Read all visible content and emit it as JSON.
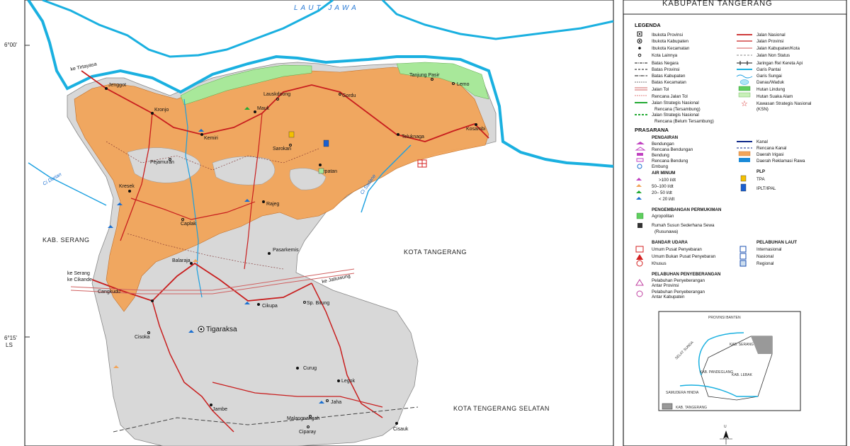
{
  "map": {
    "sea_label": "LAUT JAWA",
    "title": "KABUPATEN TANGERANG",
    "lat_ticks": [
      "6°00'",
      "6°15'",
      "LS"
    ],
    "regions": {
      "serang": "KAB. SERANG",
      "kota_tangerang": "KOTA TANGERANG",
      "kota_tangsel": "KOTA TENGERANG SELATAN"
    },
    "rivers": [
      "Ci Durian",
      "Ci Sadane"
    ],
    "places": [
      "Jenggot",
      "Kronjo",
      "Kemiri",
      "Mauk",
      "Lauskdoong",
      "Gordu",
      "Tanjung Pasir",
      "Lemo",
      "Kosambi",
      "Teluknaga",
      "Sepatan",
      "Sarokan",
      "Pejamuran",
      "Kresek",
      "Rajeg",
      "Caplak",
      "Pasarkemis",
      "Balaraja",
      "Cangkudu",
      "Cikupa",
      "Sp. Bitung",
      "Cisoka",
      "Tigaraksa",
      "Curug",
      "Legok",
      "Jambe",
      "Jaha",
      "Malangnangah",
      "Cisauk",
      "Ciparay"
    ],
    "road_labels": [
      "ke Tirtayasa",
      "ke Serang",
      "ke Cikande",
      "ke Jatiuwung"
    ]
  },
  "legend": {
    "title": "LEGENDA",
    "left_items": [
      "Ibukota Provinsi",
      "Ibukota Kabupaten",
      "Ibukota Kecamatan",
      "Kota Lainnya",
      "Batas Negara",
      "Batas Provinsi",
      "Batas Kabupaten",
      "Batas Kecamatan",
      "Jalan Tol",
      "Rencana Jalan Tol",
      "Jalan Strategis Nasional",
      "Rencana (Tersambung)",
      "Jalan Strategis Nasional",
      "Rencana (Belum Tersambung)"
    ],
    "right_items": [
      "Jalan Nasional",
      "Jalan Provinsi",
      "Jalan Kabupaten/Kota",
      "Jalan Non Status",
      "Jaringan Rel Kereta Api",
      "Garis Pantai",
      "Garis Sungai",
      "Danau/Waduk",
      "Hutan Lindung",
      "Hutan Suaka Alam",
      "Kawasan Strategis Nasional",
      "(KSN)"
    ],
    "prasarana_title": "PRASARANA",
    "pengairan": {
      "title": "PENGAIRAN",
      "items": [
        "Bendungan",
        "Rencana Bendungan",
        "Bendung",
        "Rencana Bendung",
        "Embung"
      ]
    },
    "pengairan_right": [
      "Kanal",
      "Rencana Kanal",
      "Daerah Irigasi",
      "Daerah Reklamasi Rawa"
    ],
    "air_minum": {
      "title": "AIR MINUM",
      "items": [
        ">100 l/dt",
        "50–100 l/dt",
        "20– 50 l/dt",
        "< 20 l/dt"
      ]
    },
    "plp": {
      "title": "PLP",
      "items": [
        "TPA",
        "IPLT/IPAL"
      ]
    },
    "permukiman": {
      "title": "PENGEMBANGAN PERMUKIMAN",
      "items": [
        "Agropolitan",
        "Rumah Susun Sederhana Sewa",
        "(Rusunawa)"
      ]
    },
    "bandar_udara": {
      "title": "BANDAR UDARA",
      "items": [
        "Umum Pusat Penyebaran",
        "Umum Bukan Pusat Penyebaran",
        "Khusus"
      ]
    },
    "pelabuhan_laut": {
      "title": "PELABUHAN LAUT",
      "items": [
        "Internasional",
        "Nasional",
        "Regional"
      ]
    },
    "penyeberangan": {
      "title": "PELABUHAN PENYEBERANGAN",
      "items": [
        "Pelabuhan Penyeberangan",
        "Antar Provinsi",
        "Pelabuhan Penyeberangan",
        "Antar Kabupaten"
      ]
    },
    "inset": {
      "title": "PROVINSI BANTEN",
      "labels": [
        "KAB. SERANG",
        "KAB. PANDEGLANG",
        "KAB. LEBAK",
        "SAMUDERA HINDIA",
        "SELAT SUNDA"
      ],
      "key": "KAB. TANGERANG"
    },
    "north": "U"
  },
  "colors": {
    "sea": "#ffffff",
    "land": "#dcdcdc",
    "irrigation": "#f2a55a",
    "forest": "#a8e89a",
    "coast": "#1ab0e0",
    "road_national": "#d42020"
  }
}
